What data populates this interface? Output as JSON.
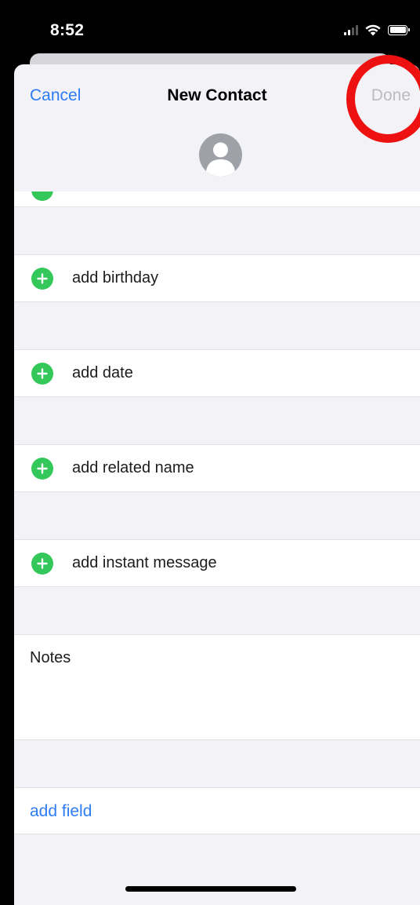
{
  "status_bar": {
    "time": "8:52",
    "icons": [
      "signal-icon",
      "wifi-icon",
      "battery-icon"
    ]
  },
  "nav": {
    "cancel_label": "Cancel",
    "title": "New Contact",
    "done_label": "Done"
  },
  "avatar": {
    "icon": "person-silhouette-icon"
  },
  "rows": {
    "birthday": "add birthday",
    "date": "add date",
    "related_name": "add related name",
    "instant_message": "add instant message"
  },
  "notes": {
    "label": "Notes"
  },
  "add_field": {
    "label": "add field"
  },
  "colors": {
    "accent": "#2d7cf6",
    "add_green": "#34c759",
    "disabled": "#bcbcc0",
    "background": "#f2f2f7",
    "annotation_ring": "#ee1111"
  }
}
